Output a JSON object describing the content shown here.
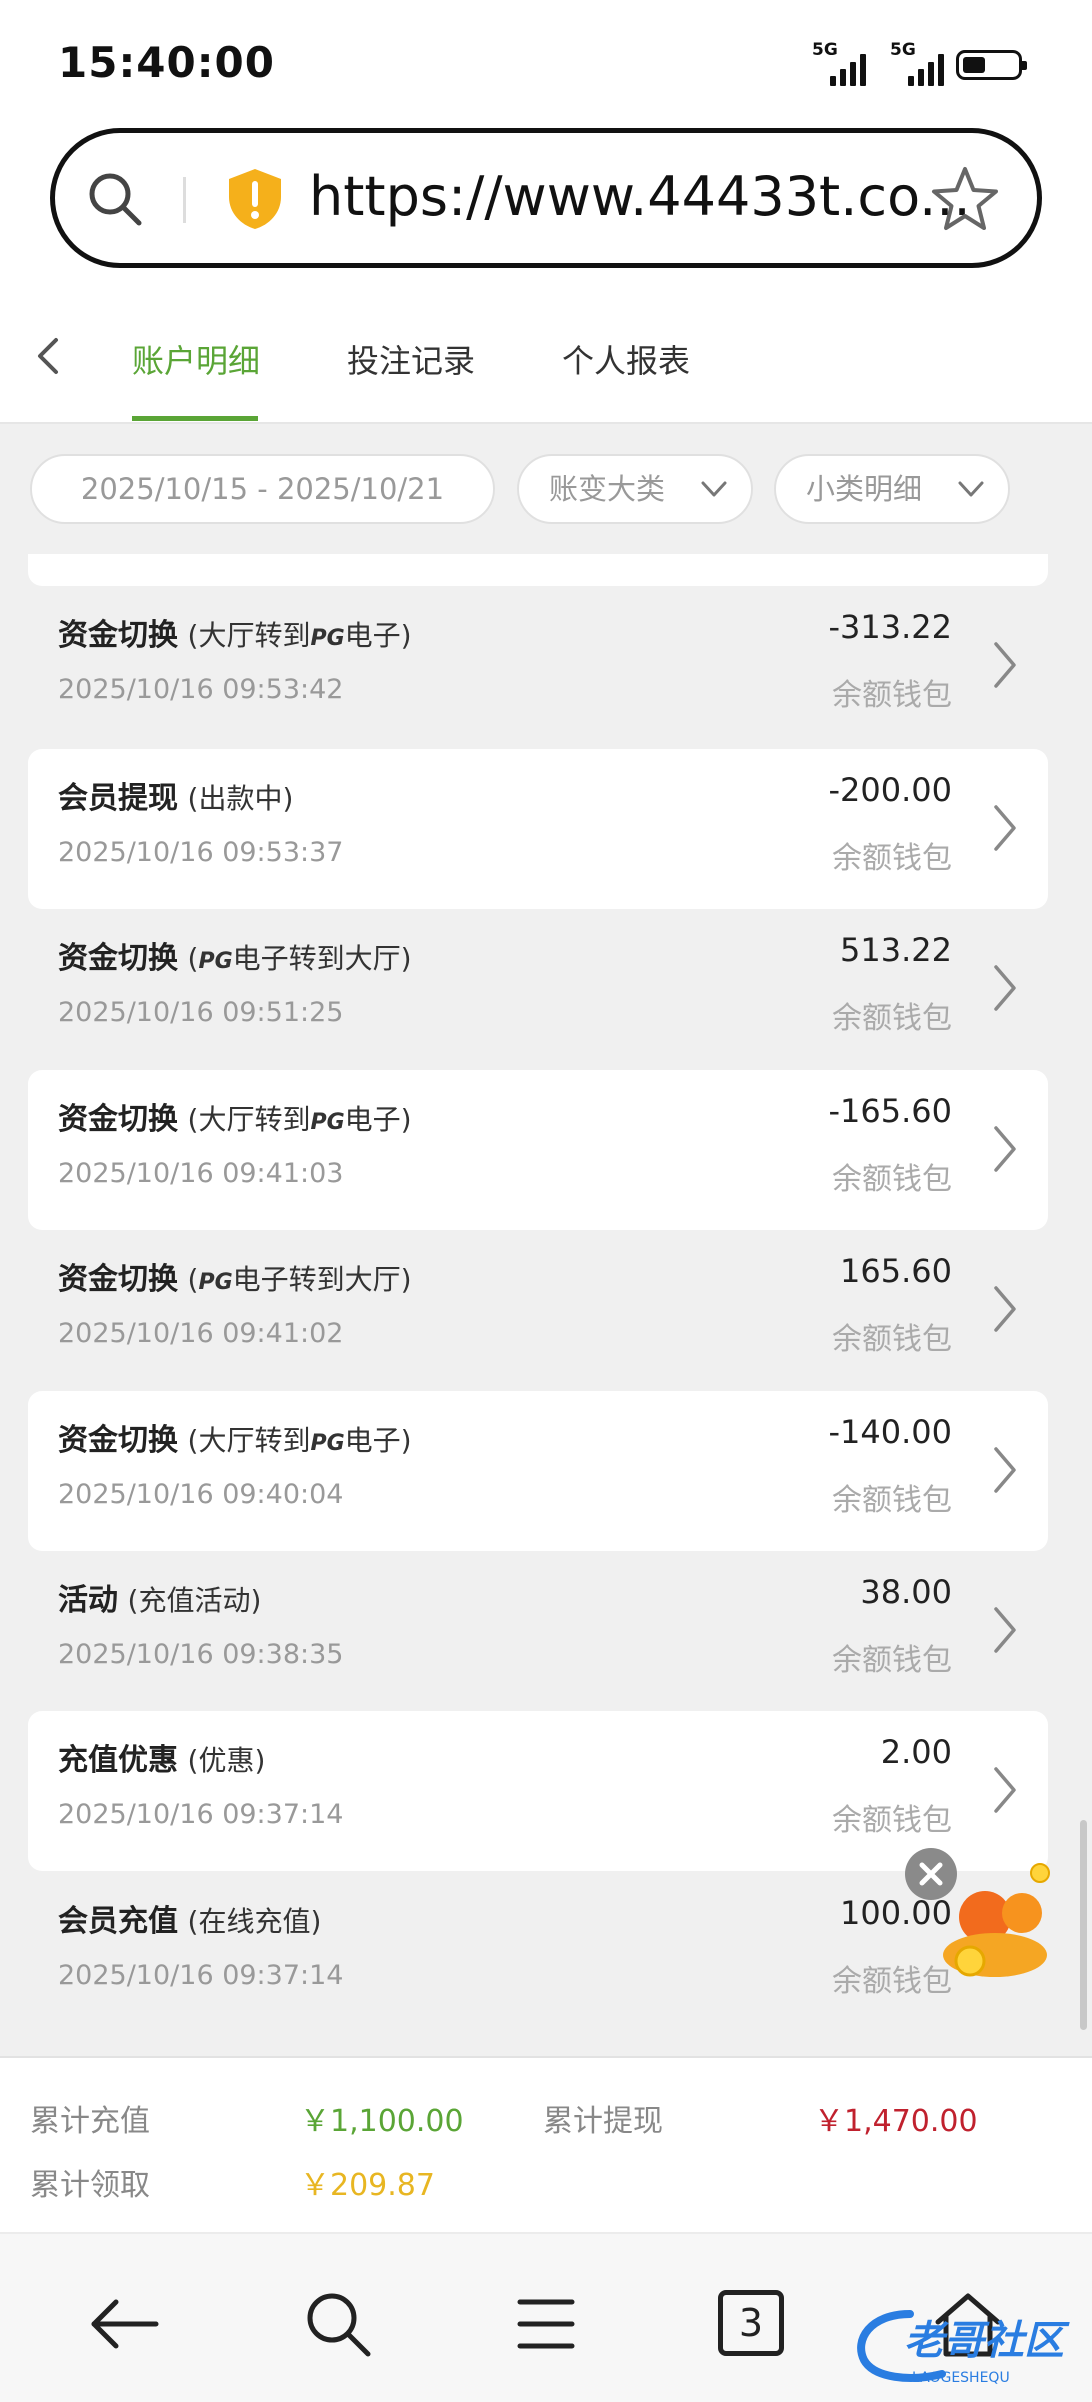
{
  "status_bar": {
    "time": "15:40:00",
    "signal_1": "5G",
    "signal_2": "5G"
  },
  "url_bar": {
    "url": "https://www.44433t.co..."
  },
  "tabs": {
    "items": [
      "账户明细",
      "投注记录",
      "个人报表"
    ]
  },
  "filters": {
    "date_range": "2025/10/15 - 2025/10/21",
    "category": "账变大类",
    "subcategory": "小类明细"
  },
  "transactions": [
    {
      "title": "资金切换",
      "detail_prefix": "(大厅转到",
      "detail_logo": "PG",
      "detail_suffix": "电子)",
      "date": "2025/10/16 09:53:42",
      "amount": "-313.22",
      "wallet": "余额钱包"
    },
    {
      "title": "会员提现",
      "detail_prefix": "(出款中)",
      "detail_logo": "",
      "detail_suffix": "",
      "date": "2025/10/16 09:53:37",
      "amount": "-200.00",
      "wallet": "余额钱包"
    },
    {
      "title": "资金切换",
      "detail_prefix": "(",
      "detail_logo": "PG",
      "detail_suffix": "电子转到大厅)",
      "date": "2025/10/16 09:51:25",
      "amount": "513.22",
      "wallet": "余额钱包"
    },
    {
      "title": "资金切换",
      "detail_prefix": "(大厅转到",
      "detail_logo": "PG",
      "detail_suffix": "电子)",
      "date": "2025/10/16 09:41:03",
      "amount": "-165.60",
      "wallet": "余额钱包"
    },
    {
      "title": "资金切换",
      "detail_prefix": "(",
      "detail_logo": "PG",
      "detail_suffix": "电子转到大厅)",
      "date": "2025/10/16 09:41:02",
      "amount": "165.60",
      "wallet": "余额钱包"
    },
    {
      "title": "资金切换",
      "detail_prefix": "(大厅转到",
      "detail_logo": "PG",
      "detail_suffix": "电子)",
      "date": "2025/10/16 09:40:04",
      "amount": "-140.00",
      "wallet": "余额钱包"
    },
    {
      "title": "活动",
      "detail_prefix": "(充值活动)",
      "detail_logo": "",
      "detail_suffix": "",
      "date": "2025/10/16 09:38:35",
      "amount": "38.00",
      "wallet": "余额钱包"
    },
    {
      "title": "充值优惠",
      "detail_prefix": "(优惠)",
      "detail_logo": "",
      "detail_suffix": "",
      "date": "2025/10/16 09:37:14",
      "amount": "2.00",
      "wallet": "余额钱包"
    },
    {
      "title": "会员充值",
      "detail_prefix": "(在线充值)",
      "detail_logo": "",
      "detail_suffix": "",
      "date": "2025/10/16 09:37:14",
      "amount": "100.00",
      "wallet": "余额钱包"
    }
  ],
  "summary": {
    "total_deposit_label": "累计充值",
    "total_deposit_value": "￥1,100.00",
    "total_withdraw_label": "累计提现",
    "total_withdraw_value": "￥1,470.00",
    "total_claim_label": "累计领取",
    "total_claim_value": "￥209.87",
    "colors": {
      "deposit": "#5aa536",
      "withdraw": "#c0212e",
      "claim": "#e8b622"
    }
  },
  "bottom_nav": {
    "tab_count": "3"
  },
  "watermark": {
    "text": "老哥社区",
    "sub": "LAOGESHEQU"
  },
  "icons": [
    "search-icon",
    "shield-warning-icon",
    "star-icon",
    "back-chevron-icon",
    "chevron-down-icon",
    "chevron-right-icon",
    "close-icon",
    "back-arrow-icon",
    "menu-icon",
    "tabs-icon",
    "home-icon"
  ]
}
